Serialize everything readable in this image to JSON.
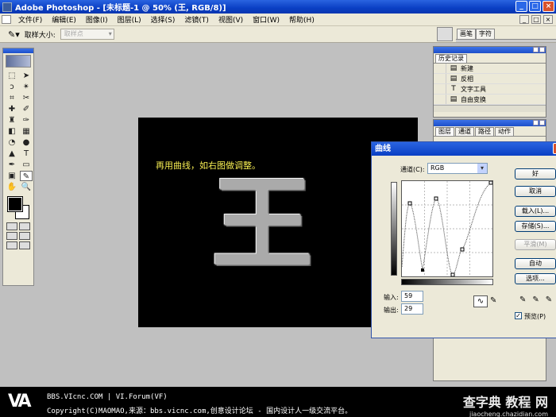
{
  "window": {
    "title": "Adobe Photoshop - [未标题-1 @ 50% (王, RGB/8)]",
    "btn_min": "_",
    "btn_max": "□",
    "btn_close": "×"
  },
  "menu": {
    "items": [
      "文件(F)",
      "编辑(E)",
      "图像(I)",
      "图层(L)",
      "选择(S)",
      "滤镜(T)",
      "视图(V)",
      "窗口(W)",
      "帮助(H)"
    ]
  },
  "options": {
    "sample_size_label": "取样大小:",
    "sample_size_value": "取样点"
  },
  "brushes_palette": {
    "tabs": [
      "画笔",
      "字符"
    ]
  },
  "history_panel": {
    "tab": "历史记录",
    "rows": [
      {
        "icon": "document-icon",
        "label": "新建"
      },
      {
        "icon": "invert-icon",
        "label": "反相"
      },
      {
        "icon": "type-icon",
        "label": "文字工具"
      },
      {
        "icon": "transform-icon",
        "label": "自由变换"
      }
    ]
  },
  "layers_panel": {
    "tabs": [
      "图层",
      "通道",
      "路径",
      "动作"
    ]
  },
  "canvas": {
    "caption": "再用曲线，如右图做调整。",
    "glyph": "王"
  },
  "curves": {
    "title": "曲线",
    "channel_label": "通道(C):",
    "channel_value": "RGB",
    "input_label": "输入:",
    "input_value": "59",
    "output_label": "输出:",
    "output_value": "29",
    "buttons": {
      "ok": "好",
      "cancel": "取消",
      "load": "载入(L)...",
      "save": "存储(S)...",
      "smooth": "平滑(M)",
      "auto": "自动",
      "options": "选项..."
    },
    "preview_label": "预览(P)",
    "preview_checked": true
  },
  "footer": {
    "logo": "VA",
    "line1": "BBS.VIcnc.COM | VI.Forum(VF)",
    "line2": "Copyright(C)MAOMAO,来源：bbs.vicnc.com,创意设计论坛 - 国内设计人一级交流平台。",
    "watermark_top": "查字典 教程 网",
    "watermark_bottom": "jiaocheng.chazidian.com"
  }
}
